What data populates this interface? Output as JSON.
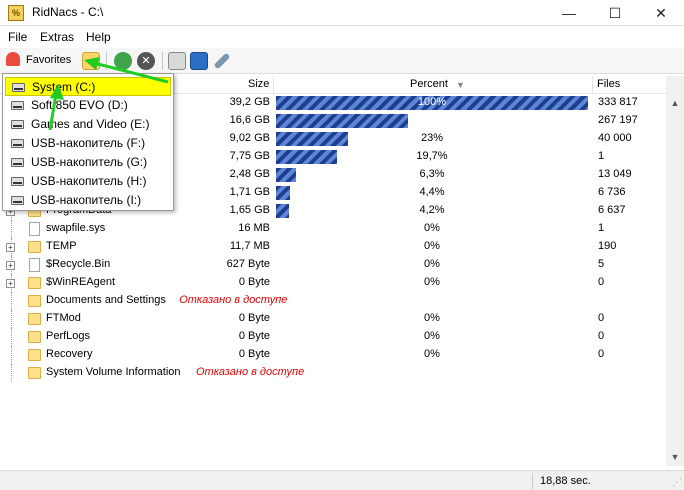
{
  "window": {
    "title": "RidNacs - C:\\"
  },
  "menu": [
    "File",
    "Extras",
    "Help"
  ],
  "toolbar": {
    "favorites_label": "Favorites"
  },
  "columns": {
    "size": "Size",
    "percent": "Percent",
    "files": "Files"
  },
  "favorites_menu": [
    {
      "label": "System (C:)"
    },
    {
      "label": "Soft 850 EVO (D:)"
    },
    {
      "label": "Games and Video (E:)"
    },
    {
      "label": "USB-накопитель (F:)"
    },
    {
      "label": "USB-накопитель (G:)"
    },
    {
      "label": "USB-накопитель (H:)"
    },
    {
      "label": "USB-накопитель (I:)"
    }
  ],
  "rows": [
    {
      "name": "",
      "size": "39,2 GB",
      "percent": "100%",
      "bar": 1.0,
      "files": "333 817",
      "denied": ""
    },
    {
      "name": "",
      "size": "16,6 GB",
      "percent": "42,3%",
      "bar": 0.423,
      "files": "267 197",
      "denied": ""
    },
    {
      "name": "",
      "size": "9,02 GB",
      "percent": "23%",
      "bar": 0.23,
      "files": "40 000",
      "denied": ""
    },
    {
      "name": "",
      "size": "7,75 GB",
      "percent": "19,7%",
      "bar": 0.197,
      "files": "1",
      "denied": ""
    },
    {
      "name": "",
      "size": "2,48 GB",
      "percent": "6,3%",
      "bar": 0.063,
      "files": "13 049",
      "denied": ""
    },
    {
      "name": "",
      "size": "1,71 GB",
      "percent": "4,4%",
      "bar": 0.044,
      "files": "6 736",
      "denied": ""
    },
    {
      "name": "ProgramData",
      "size": "1,65 GB",
      "percent": "4,2%",
      "bar": 0.042,
      "files": "6 637",
      "denied": ""
    },
    {
      "name": "swapfile.sys",
      "size": "16 MB",
      "percent": "0%",
      "bar": 0,
      "files": "1",
      "denied": ""
    },
    {
      "name": "TEMP",
      "size": "11,7 MB",
      "percent": "0%",
      "bar": 0,
      "files": "190",
      "denied": ""
    },
    {
      "name": "$Recycle.Bin",
      "size": "627 Byte",
      "percent": "0%",
      "bar": 0,
      "files": "5",
      "denied": ""
    },
    {
      "name": "$WinREAgent",
      "size": "0 Byte",
      "percent": "0%",
      "bar": 0,
      "files": "0",
      "denied": ""
    },
    {
      "name": "Documents and Settings",
      "size": "",
      "percent": "",
      "bar": 0,
      "files": "",
      "denied": "Отказано в доступе"
    },
    {
      "name": "FTMod",
      "size": "0 Byte",
      "percent": "0%",
      "bar": 0,
      "files": "0",
      "denied": ""
    },
    {
      "name": "PerfLogs",
      "size": "0 Byte",
      "percent": "0%",
      "bar": 0,
      "files": "0",
      "denied": ""
    },
    {
      "name": "Recovery",
      "size": "0 Byte",
      "percent": "0%",
      "bar": 0,
      "files": "0",
      "denied": ""
    },
    {
      "name": "System Volume Information",
      "size": "",
      "percent": "",
      "bar": 0,
      "files": "",
      "denied": "Отказано в доступе"
    }
  ],
  "status": {
    "time": "18,88 sec."
  },
  "colors": {
    "bar_dark": "#1c3f8f",
    "bar_light": "#5f86d6",
    "denied": "#e00000",
    "highlight": "#ffff00",
    "arrow": "#22cc22"
  }
}
